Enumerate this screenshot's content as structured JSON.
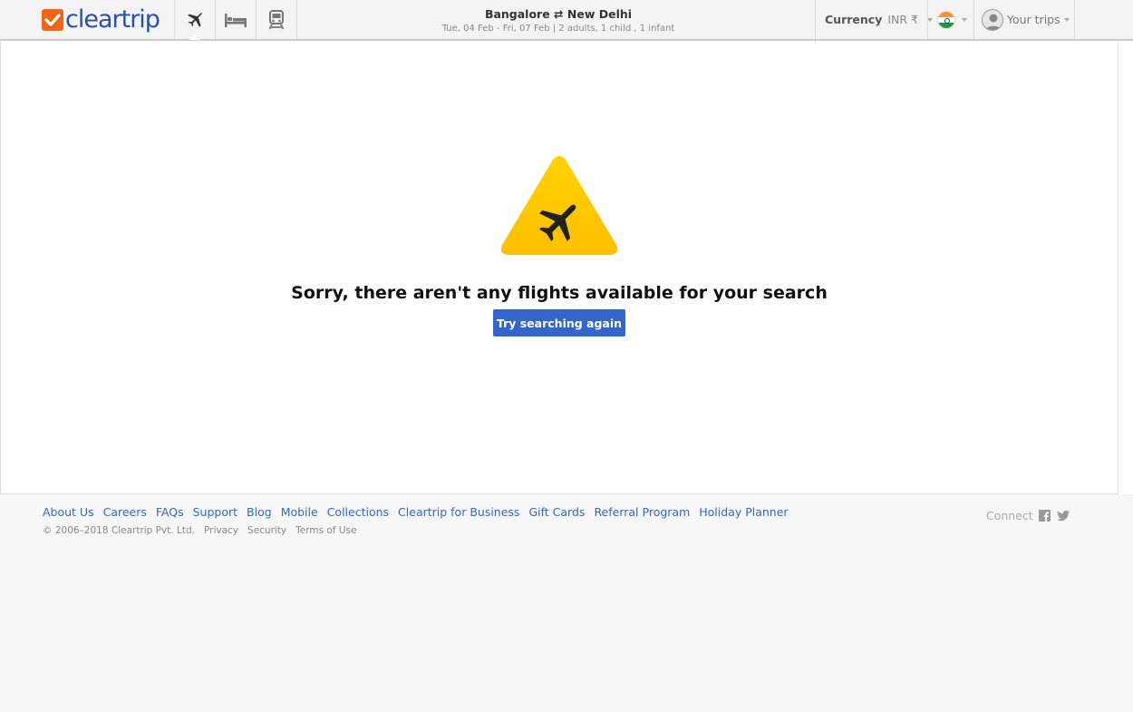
{
  "brand": {
    "name": "cleartrip"
  },
  "nav": [
    {
      "name": "flights",
      "icon": "airplane-icon",
      "active": true
    },
    {
      "name": "hotels",
      "icon": "bed-icon",
      "active": false
    },
    {
      "name": "trains",
      "icon": "train-icon",
      "active": false
    }
  ],
  "search_summary": {
    "route": "Bangalore ⇄ New Delhi",
    "details": "Tue, 04 Feb - Fri, 07 Feb | 2 adults, 1 child , 1 infant"
  },
  "header": {
    "currency_label": "Currency",
    "currency_value": "INR ₹",
    "country_icon": "india-flag-icon",
    "trips_label": "Your trips"
  },
  "main": {
    "message": "Sorry, there aren't any flights available for your search",
    "retry_label": "Try searching again"
  },
  "footer": {
    "links": [
      "About Us",
      "Careers",
      "FAQs",
      "Support",
      "Blog",
      "Mobile",
      "Collections",
      "Cleartrip for Business",
      "Gift Cards",
      "Referral Program",
      "Holiday Planner"
    ],
    "copyright": "© 2006–2018 Cleartrip Pvt. Ltd.",
    "legal_links": [
      "Privacy",
      "Security",
      "Terms of Use"
    ],
    "connect_label": "Connect"
  },
  "colors": {
    "brand_orange": "#ef6614",
    "brand_blue": "#2a4fb0",
    "link_blue": "#3366cc",
    "warning_yellow": "#ffc400"
  }
}
